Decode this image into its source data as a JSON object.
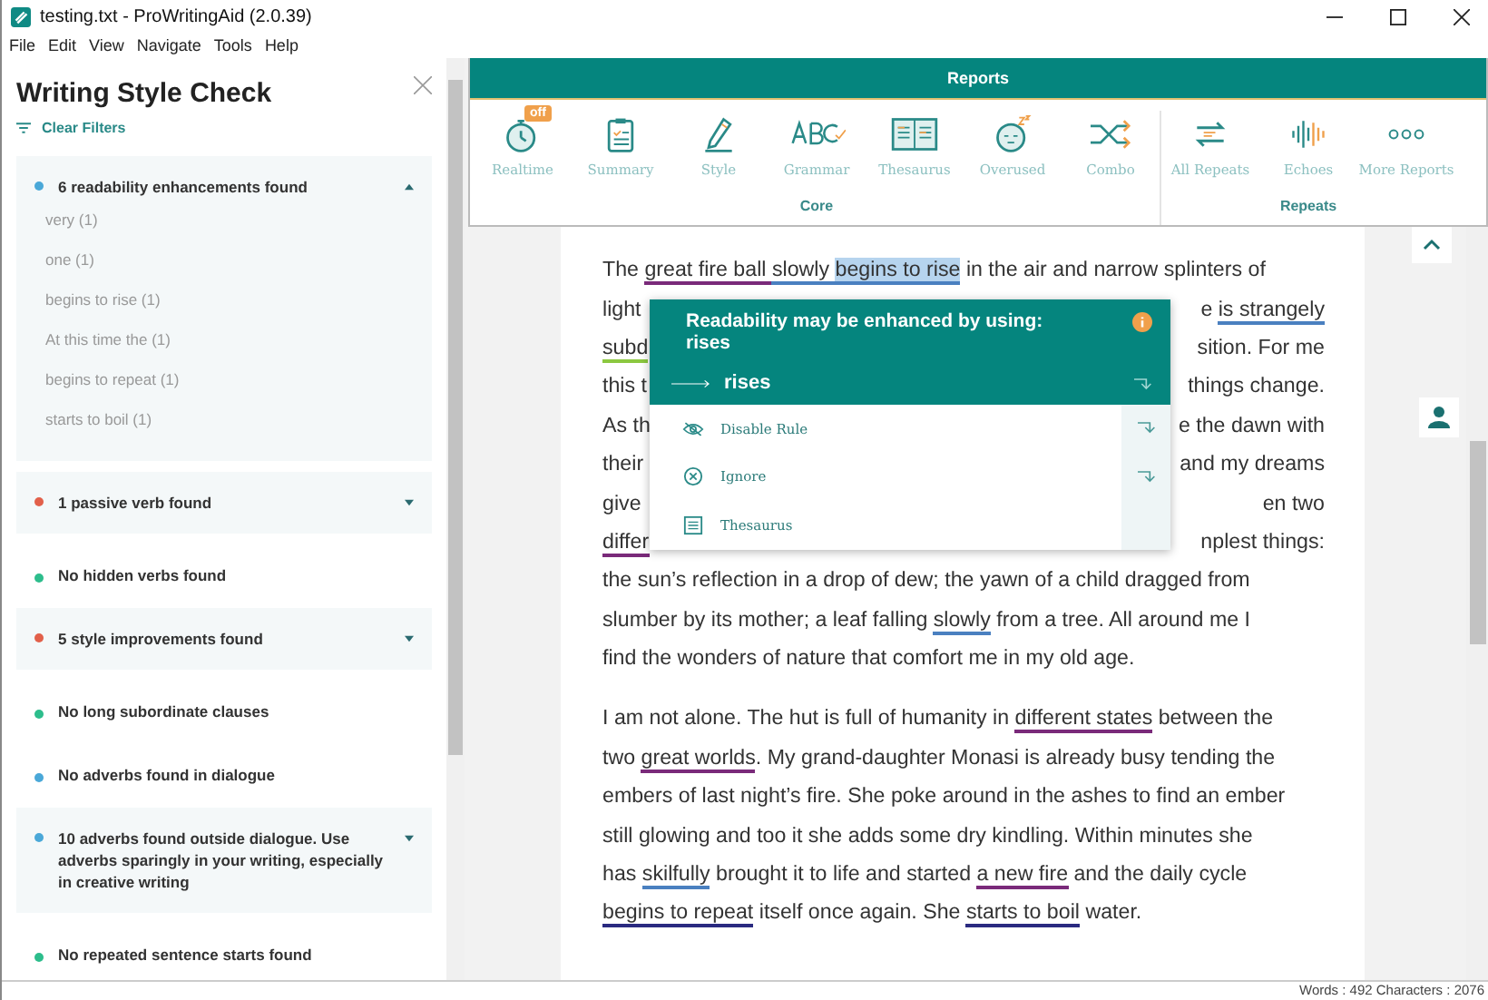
{
  "window": {
    "title": "testing.txt - ProWritingAid (2.0.39)"
  },
  "menu": [
    "File",
    "Edit",
    "View",
    "Navigate",
    "Tools",
    "Help"
  ],
  "sidebar": {
    "title": "Writing Style Check",
    "filter_link": "Clear Filters",
    "groups": [
      {
        "kind": "collapsible",
        "color": "#4aa8d8",
        "text": "6 readability enhancements found",
        "expanded": true,
        "items": [
          "very (1)",
          "one (1)",
          "begins to rise (1)",
          "At this time the (1)",
          "begins to repeat (1)",
          "starts to boil (1)"
        ]
      },
      {
        "kind": "collapsible",
        "color": "#e2604a",
        "text": "1 passive verb found",
        "expanded": false
      },
      {
        "kind": "note",
        "color": "#2dbd8c",
        "text": "No hidden verbs found"
      },
      {
        "kind": "collapsible",
        "color": "#e2604a",
        "text": "5 style improvements found",
        "expanded": false
      },
      {
        "kind": "note",
        "color": "#2dbd8c",
        "text": "No long subordinate clauses"
      },
      {
        "kind": "note",
        "color": "#4aa8d8",
        "text": "No adverbs found in dialogue"
      },
      {
        "kind": "collapsible",
        "color": "#4aa8d8",
        "text": "10 adverbs found outside dialogue. Use adverbs sparingly in your writing, especially in creative writing",
        "expanded": false
      },
      {
        "kind": "note",
        "color": "#2dbd8c",
        "text": "No repeated sentence starts found"
      }
    ]
  },
  "reports": {
    "title": "Reports",
    "sections": [
      {
        "label": "Core",
        "tools": [
          {
            "kind": "stopwatch",
            "label": "Realtime",
            "badge": "off"
          },
          {
            "kind": "clipboard",
            "label": "Summary"
          },
          {
            "kind": "pencil",
            "label": "Style"
          },
          {
            "kind": "abc",
            "label": "Grammar"
          },
          {
            "kind": "book",
            "label": "Thesaurus"
          },
          {
            "kind": "sleepy",
            "label": "Overused"
          },
          {
            "kind": "shuffle",
            "label": "Combo"
          }
        ]
      },
      {
        "label": "Repeats",
        "tools": [
          {
            "kind": "repeat",
            "label": "All Repeats"
          },
          {
            "kind": "wave",
            "label": "Echoes"
          },
          {
            "kind": "dots",
            "label": "More Reports"
          }
        ]
      }
    ]
  },
  "editor": {
    "paragraphs": [
      {
        "lines": [
          {
            "left": [
              {
                "kind": "text",
                "text": "The "
              },
              {
                "kind": "flag",
                "text": "great fire ball ",
                "color": "#7a2a7a"
              },
              {
                "kind": "flag",
                "text": "slowly ",
                "color": "#4a80c0"
              },
              {
                "kind": "current",
                "text": "begins to rise",
                "color": "#4a80c0"
              },
              {
                "kind": "text",
                "text": " in the air and narrow splinters of"
              }
            ]
          },
          {
            "left": [
              {
                "kind": "text",
                "text": "light"
              }
            ],
            "right": [
              {
                "kind": "text",
                "text": "e "
              },
              {
                "kind": "flag",
                "text": "is strangely",
                "color": "#4a80c0"
              }
            ]
          },
          {
            "left": [
              {
                "kind": "flag",
                "text": "subd",
                "color": "#8cc840"
              }
            ],
            "right": [
              {
                "kind": "text",
                "text": "sition. For me"
              }
            ]
          },
          {
            "left": [
              {
                "kind": "text",
                "text": "this t"
              }
            ],
            "right": [
              {
                "kind": "text",
                "text": "things change."
              }
            ]
          },
          {
            "left": [
              {
                "kind": "text",
                "text": "As th"
              }
            ],
            "right": [
              {
                "kind": "text",
                "text": "e the dawn with"
              }
            ]
          },
          {
            "left": [
              {
                "kind": "text",
                "text": "their"
              }
            ],
            "right": [
              {
                "kind": "text",
                "text": "and my dreams"
              }
            ]
          },
          {
            "left": [
              {
                "kind": "text",
                "text": "give"
              }
            ],
            "right": [
              {
                "kind": "text",
                "text": "en two"
              }
            ]
          },
          {
            "left": [
              {
                "kind": "flag",
                "text": "differ",
                "color": "#7a2a7a"
              }
            ],
            "right": [
              {
                "kind": "text",
                "text": "nplest things:"
              }
            ]
          },
          {
            "left": [
              {
                "kind": "text",
                "text": "the sun’s reflection in a drop of dew; the yawn of a child dragged from"
              }
            ]
          },
          {
            "left": [
              {
                "kind": "text",
                "text": "slumber by its mother; a leaf falling "
              },
              {
                "kind": "flag",
                "text": "slowly",
                "color": "#4a80c0"
              },
              {
                "kind": "text",
                "text": " from a tree. All around me I"
              }
            ]
          },
          {
            "left": [
              {
                "kind": "text",
                "text": "find the wonders of nature that comfort me in my old age."
              }
            ]
          }
        ]
      },
      {
        "lines": [
          {
            "left": [
              {
                "kind": "text",
                "text": "I am not alone. The hut is full of humanity in "
              },
              {
                "kind": "flag",
                "text": "different states",
                "color": "#7a2a7a"
              },
              {
                "kind": "text",
                "text": " between the"
              }
            ]
          },
          {
            "left": [
              {
                "kind": "text",
                "text": "two "
              },
              {
                "kind": "flag",
                "text": "great worlds",
                "color": "#7a2a7a"
              },
              {
                "kind": "text",
                "text": ". My grand-daughter Monasi is already busy tending the"
              }
            ]
          },
          {
            "left": [
              {
                "kind": "text",
                "text": "embers of last night’s fire. She poke around in the ashes to find an ember"
              }
            ]
          },
          {
            "left": [
              {
                "kind": "text",
                "text": "still glowing and too it she adds some dry kindling. Within minutes she"
              }
            ]
          },
          {
            "left": [
              {
                "kind": "text",
                "text": "has "
              },
              {
                "kind": "flag",
                "text": "skilfully",
                "color": "#4a80c0"
              },
              {
                "kind": "text",
                "text": " brought it to life and started "
              },
              {
                "kind": "flag",
                "text": "a new fire",
                "color": "#7a2a7a"
              },
              {
                "kind": "text",
                "text": " and the daily cycle"
              }
            ]
          },
          {
            "left": [
              {
                "kind": "flag",
                "text": "begins to repeat",
                "color": "#2a2a80"
              },
              {
                "kind": "text",
                "text": " itself once again. She "
              },
              {
                "kind": "flag",
                "text": "starts to boil",
                "color": "#2a2a80"
              },
              {
                "kind": "text",
                "text": " water."
              }
            ]
          }
        ]
      }
    ]
  },
  "popup": {
    "message": "Readability may be enhanced by using: rises",
    "suggestion": "rises",
    "options": [
      {
        "kind": "disable",
        "label": "Disable Rule",
        "arrow": true
      },
      {
        "kind": "ignore",
        "label": "Ignore",
        "arrow": true
      },
      {
        "kind": "thesaurus",
        "label": "Thesaurus",
        "arrow": false
      }
    ]
  },
  "status_bar": "Words : 492 Characters : 2076"
}
